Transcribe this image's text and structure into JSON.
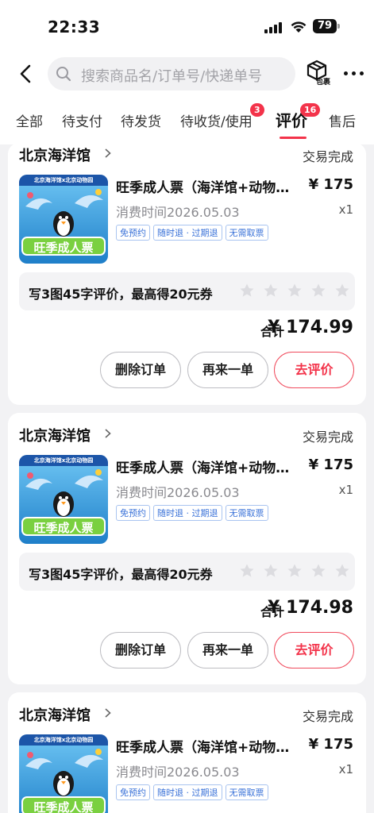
{
  "status_bar": {
    "time": "22:33",
    "battery": "79"
  },
  "nav": {
    "search_placeholder": "搜索商品名/订单号/快递单号",
    "package_label": "包裹"
  },
  "tabs": [
    {
      "label": "全部"
    },
    {
      "label": "待支付"
    },
    {
      "label": "待发货"
    },
    {
      "label": "待收货/使用",
      "badge": "3"
    },
    {
      "label": "评价",
      "badge": "16",
      "active": true
    },
    {
      "label": "售后"
    }
  ],
  "orders": [
    {
      "store": "北京海洋馆",
      "status": "交易完成",
      "thumbnail": {
        "header": "北京海洋馆x北京动物园",
        "banner": "旺季成人票"
      },
      "product_title": "旺季成人票（海洋馆+动物园）",
      "price": "¥ 175",
      "consume_time": "消费时间2026.05.03",
      "quantity": "x1",
      "tags": [
        "免预约",
        "随时退 · 过期退",
        "无需取票"
      ],
      "review_prompt": "写3图45字评价，最高得20元券",
      "total_label": "合计",
      "total": "¥ 174.99",
      "buttons": {
        "delete": "删除订单",
        "rebuy": "再来一单",
        "review": "去评价"
      }
    },
    {
      "store": "北京海洋馆",
      "status": "交易完成",
      "thumbnail": {
        "header": "北京海洋馆x北京动物园",
        "banner": "旺季成人票"
      },
      "product_title": "旺季成人票（海洋馆+动物园）",
      "price": "¥ 175",
      "consume_time": "消费时间2026.05.03",
      "quantity": "x1",
      "tags": [
        "免预约",
        "随时退 · 过期退",
        "无需取票"
      ],
      "review_prompt": "写3图45字评价，最高得20元券",
      "total_label": "合计",
      "total": "¥ 174.98",
      "buttons": {
        "delete": "删除订单",
        "rebuy": "再来一单",
        "review": "去评价"
      }
    },
    {
      "store": "北京海洋馆",
      "status": "交易完成",
      "thumbnail": {
        "header": "北京海洋馆x北京动物园",
        "banner": "旺季成人票"
      },
      "product_title": "旺季成人票（海洋馆+动物园）",
      "price": "¥ 175",
      "consume_time": "消费时间2026.05.03",
      "quantity": "x1",
      "tags": [
        "免预约",
        "随时退 · 过期退",
        "无需取票"
      ]
    }
  ],
  "colors": {
    "accent": "#f3334a",
    "tag_blue": "#3a72d8",
    "page_bg": "#f2f2f4"
  }
}
